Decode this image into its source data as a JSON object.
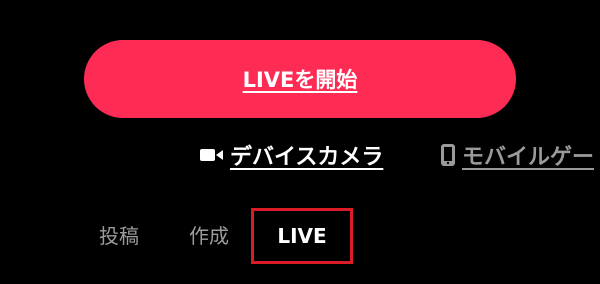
{
  "colors": {
    "background": "#000000",
    "accent": "#fe2c55",
    "highlight_border": "#d91c25",
    "muted_text": "#9b9b9b",
    "primary_text": "#ffffff"
  },
  "main": {
    "start_button_label": "LIVEを開始"
  },
  "sources": [
    {
      "label": "デバイスカメラ",
      "icon": "video-camera-icon"
    },
    {
      "label": "モバイルゲー",
      "icon": "mobile-phone-icon"
    }
  ],
  "tabs": [
    {
      "label": "投稿"
    },
    {
      "label": "作成"
    },
    {
      "label": "LIVE",
      "selected": true
    }
  ]
}
